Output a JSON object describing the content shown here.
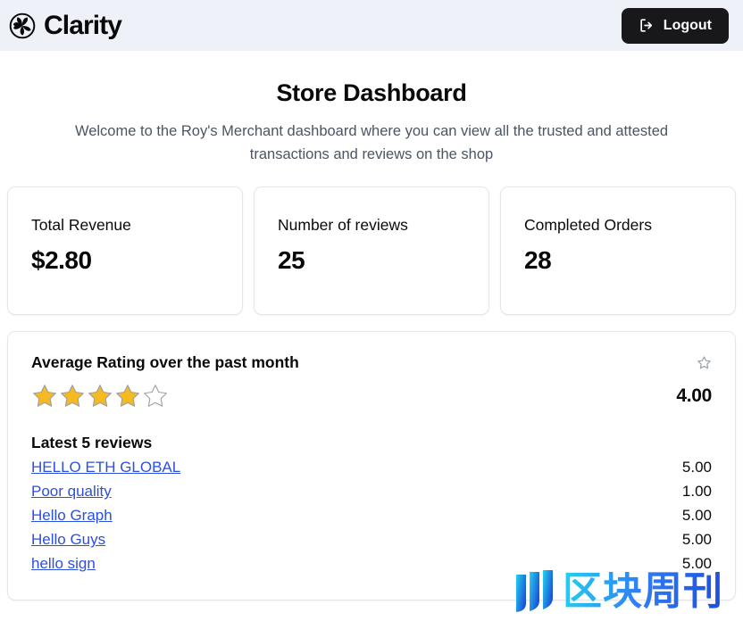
{
  "header": {
    "brand_name": "Clarity",
    "brand_icon": "spiral-pinwheel-logo",
    "logout_label": "Logout",
    "logout_icon": "logout-arrow-icon",
    "background_color": "#eef1f7",
    "logout_background_color": "#18181b"
  },
  "page": {
    "title": "Store Dashboard",
    "subtitle": "Welcome to the Roy's Merchant dashboard where you can view all the trusted and attested transactions and reviews on the shop"
  },
  "stats": [
    {
      "label": "Total Revenue",
      "value": "$2.80"
    },
    {
      "label": "Number of reviews",
      "value": "25"
    },
    {
      "label": "Completed Orders",
      "value": "28"
    }
  ],
  "rating_panel": {
    "title": "Average Rating over the past month",
    "corner_icon": "star-outline-icon",
    "stars_filled": 4,
    "stars_total": 5,
    "star_color": "#f5b921",
    "star_empty_color": "#ffffff",
    "star_outline_color": "#9aa0a6",
    "value": "4.00",
    "reviews_title": "Latest 5 reviews",
    "reviews": [
      {
        "title": "HELLO ETH GLOBAL",
        "score": "5.00"
      },
      {
        "title": "Poor quality",
        "score": "1.00"
      },
      {
        "title": "Hello Graph",
        "score": "5.00"
      },
      {
        "title": "Hello Guys",
        "score": "5.00"
      },
      {
        "title": "hello sign",
        "score": "5.00"
      }
    ],
    "link_color": "#2c4fe0"
  },
  "watermark": {
    "text": "区块周刊",
    "icon": "three-bars-logo",
    "gradient_start": "#22d3ee",
    "gradient_end": "#1d4ed8"
  }
}
